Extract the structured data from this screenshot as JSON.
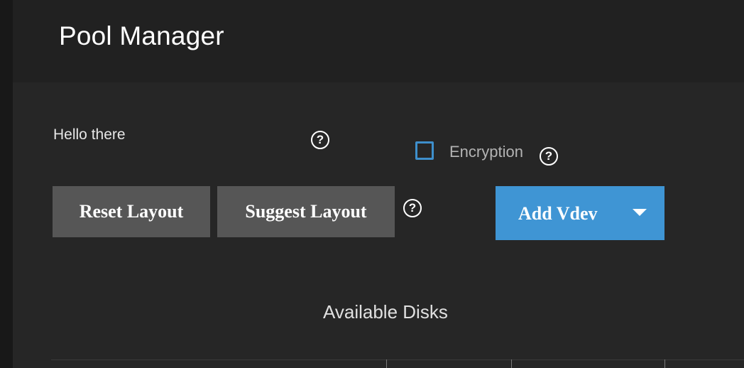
{
  "header": {
    "title": "Pool Manager"
  },
  "form": {
    "name_label": "Hello there",
    "encryption_label": "Encryption",
    "encryption_checked": false
  },
  "buttons": {
    "reset_label": "Reset Layout",
    "suggest_label": "Suggest Layout",
    "add_vdev_label": "Add Vdev"
  },
  "icons": {
    "help": "help-circle-icon",
    "dropdown": "caret-down-icon"
  },
  "disks": {
    "section_title": "Available Disks"
  },
  "colors": {
    "accent": "#3f95d4",
    "checkbox_border": "#3e8fcc",
    "button_gray": "#565656"
  }
}
